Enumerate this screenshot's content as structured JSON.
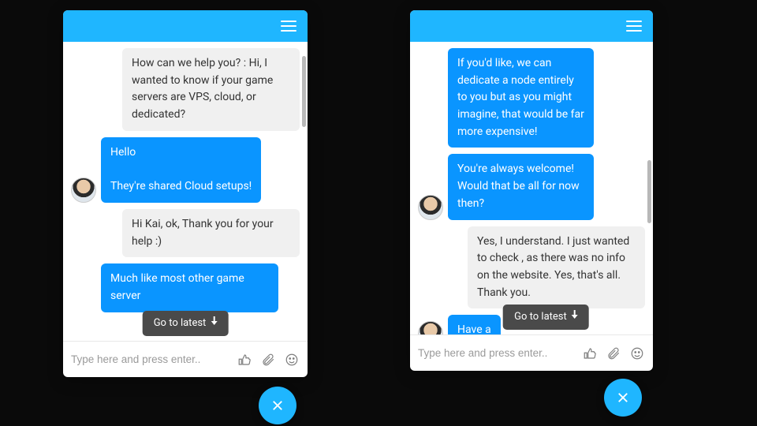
{
  "colors": {
    "accent": "#1fb6ff",
    "bubble_blue": "#0a95ff",
    "bubble_grey": "#f0f0f0"
  },
  "go_latest_label": "Go to latest",
  "input_placeholder": "Type here and press enter..",
  "left": {
    "messages": [
      {
        "side": "outgoing",
        "style": "grey",
        "text": "How can we help you? : Hi, I wanted to know if your game servers are VPS, cloud, or dedicated?"
      },
      {
        "side": "incoming",
        "style": "blue",
        "avatar": true,
        "text": "Hello\n\nThey're shared Cloud setups!"
      },
      {
        "side": "outgoing",
        "style": "grey",
        "text": "Hi Kai, ok, Thank you for your help :)"
      },
      {
        "side": "incoming",
        "style": "blue",
        "indent": true,
        "text": "Much like most other game server"
      }
    ]
  },
  "right": {
    "messages": [
      {
        "side": "incoming",
        "style": "blue",
        "indent": true,
        "text": "If you'd like, we can dedicate a node entirely to you but as you might imagine, that would be far more expensive!"
      },
      {
        "side": "incoming",
        "style": "blue",
        "avatar": true,
        "text": "You're always welcome! Would that be all for now then?"
      },
      {
        "side": "outgoing",
        "style": "grey",
        "text": "Yes, I understand. I just wanted to check , as there was no info on the website. Yes, that's all. Thank you."
      },
      {
        "side": "incoming",
        "style": "blue",
        "avatar": true,
        "text": "Have a"
      }
    ]
  }
}
